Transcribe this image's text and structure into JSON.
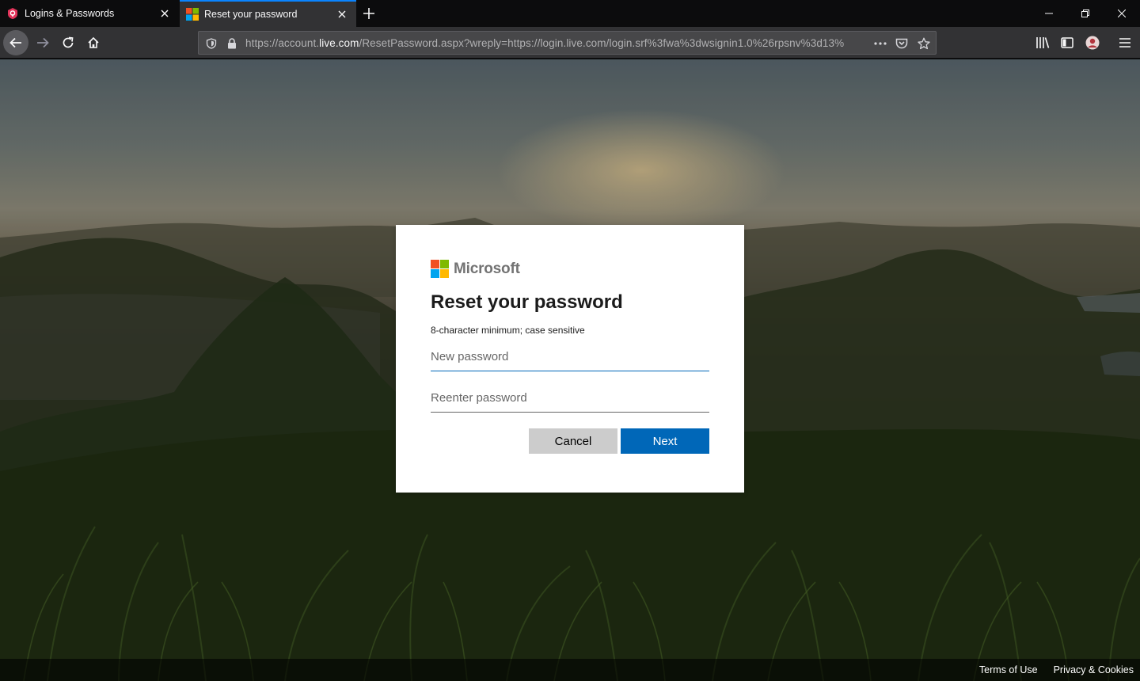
{
  "browser": {
    "tabs": [
      {
        "title": "Logins & Passwords",
        "active": false
      },
      {
        "title": "Reset your password",
        "active": true
      }
    ],
    "url": {
      "prefix": "https://account.",
      "domain": "live.com",
      "path": "/ResetPassword.aspx?wreply=https://login.live.com/login.srf%3fwa%3dwsignin1.0%26rpsnv%3d13%"
    },
    "accent_color": "#0a84ff"
  },
  "dialog": {
    "brand": "Microsoft",
    "brand_colors": [
      "#f25022",
      "#7fba00",
      "#00a4ef",
      "#ffb900"
    ],
    "heading": "Reset your password",
    "hint": "8-character minimum; case sensitive",
    "new_password_placeholder": "New password",
    "reenter_password_placeholder": "Reenter password",
    "cancel_label": "Cancel",
    "next_label": "Next",
    "primary_color": "#0067b8"
  },
  "footer": {
    "terms": "Terms of Use",
    "privacy": "Privacy & Cookies"
  }
}
